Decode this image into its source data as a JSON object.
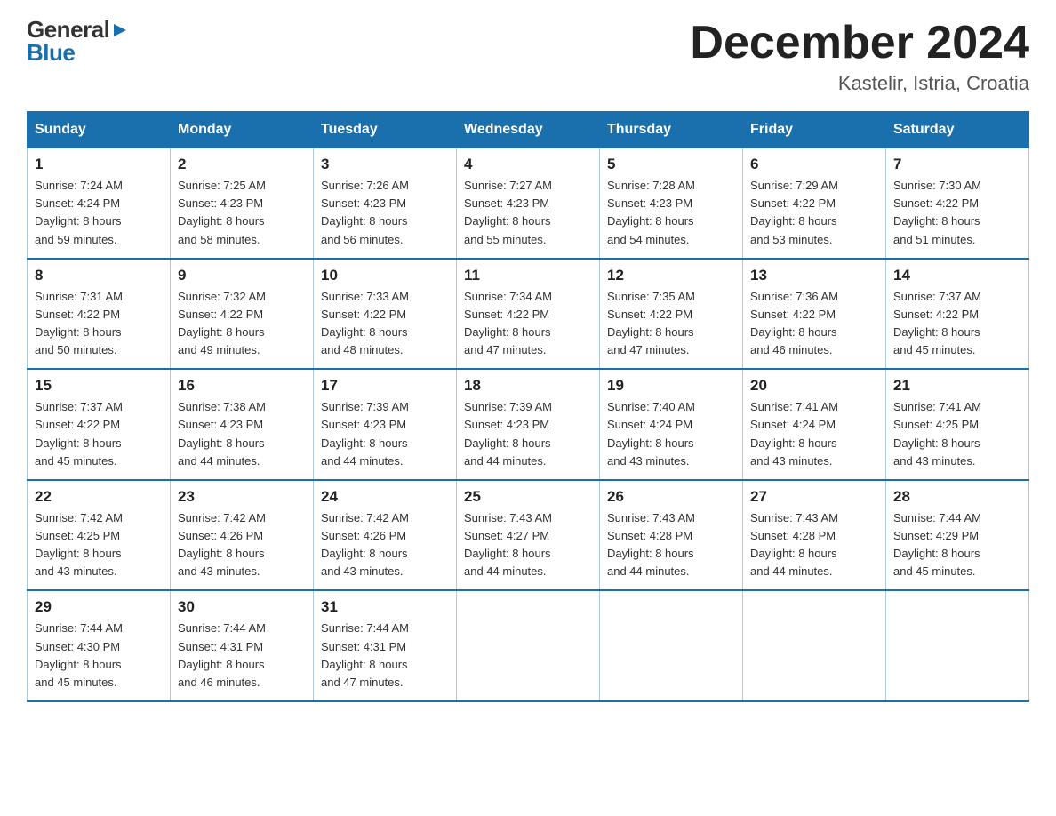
{
  "header": {
    "logo_general": "General",
    "logo_blue": "Blue",
    "month_title": "December 2024",
    "location": "Kastelir, Istria, Croatia"
  },
  "weekdays": [
    "Sunday",
    "Monday",
    "Tuesday",
    "Wednesday",
    "Thursday",
    "Friday",
    "Saturday"
  ],
  "weeks": [
    [
      {
        "day": "1",
        "sunrise": "7:24 AM",
        "sunset": "4:24 PM",
        "daylight": "8 hours and 59 minutes."
      },
      {
        "day": "2",
        "sunrise": "7:25 AM",
        "sunset": "4:23 PM",
        "daylight": "8 hours and 58 minutes."
      },
      {
        "day": "3",
        "sunrise": "7:26 AM",
        "sunset": "4:23 PM",
        "daylight": "8 hours and 56 minutes."
      },
      {
        "day": "4",
        "sunrise": "7:27 AM",
        "sunset": "4:23 PM",
        "daylight": "8 hours and 55 minutes."
      },
      {
        "day": "5",
        "sunrise": "7:28 AM",
        "sunset": "4:23 PM",
        "daylight": "8 hours and 54 minutes."
      },
      {
        "day": "6",
        "sunrise": "7:29 AM",
        "sunset": "4:22 PM",
        "daylight": "8 hours and 53 minutes."
      },
      {
        "day": "7",
        "sunrise": "7:30 AM",
        "sunset": "4:22 PM",
        "daylight": "8 hours and 51 minutes."
      }
    ],
    [
      {
        "day": "8",
        "sunrise": "7:31 AM",
        "sunset": "4:22 PM",
        "daylight": "8 hours and 50 minutes."
      },
      {
        "day": "9",
        "sunrise": "7:32 AM",
        "sunset": "4:22 PM",
        "daylight": "8 hours and 49 minutes."
      },
      {
        "day": "10",
        "sunrise": "7:33 AM",
        "sunset": "4:22 PM",
        "daylight": "8 hours and 48 minutes."
      },
      {
        "day": "11",
        "sunrise": "7:34 AM",
        "sunset": "4:22 PM",
        "daylight": "8 hours and 47 minutes."
      },
      {
        "day": "12",
        "sunrise": "7:35 AM",
        "sunset": "4:22 PM",
        "daylight": "8 hours and 47 minutes."
      },
      {
        "day": "13",
        "sunrise": "7:36 AM",
        "sunset": "4:22 PM",
        "daylight": "8 hours and 46 minutes."
      },
      {
        "day": "14",
        "sunrise": "7:37 AM",
        "sunset": "4:22 PM",
        "daylight": "8 hours and 45 minutes."
      }
    ],
    [
      {
        "day": "15",
        "sunrise": "7:37 AM",
        "sunset": "4:22 PM",
        "daylight": "8 hours and 45 minutes."
      },
      {
        "day": "16",
        "sunrise": "7:38 AM",
        "sunset": "4:23 PM",
        "daylight": "8 hours and 44 minutes."
      },
      {
        "day": "17",
        "sunrise": "7:39 AM",
        "sunset": "4:23 PM",
        "daylight": "8 hours and 44 minutes."
      },
      {
        "day": "18",
        "sunrise": "7:39 AM",
        "sunset": "4:23 PM",
        "daylight": "8 hours and 44 minutes."
      },
      {
        "day": "19",
        "sunrise": "7:40 AM",
        "sunset": "4:24 PM",
        "daylight": "8 hours and 43 minutes."
      },
      {
        "day": "20",
        "sunrise": "7:41 AM",
        "sunset": "4:24 PM",
        "daylight": "8 hours and 43 minutes."
      },
      {
        "day": "21",
        "sunrise": "7:41 AM",
        "sunset": "4:25 PM",
        "daylight": "8 hours and 43 minutes."
      }
    ],
    [
      {
        "day": "22",
        "sunrise": "7:42 AM",
        "sunset": "4:25 PM",
        "daylight": "8 hours and 43 minutes."
      },
      {
        "day": "23",
        "sunrise": "7:42 AM",
        "sunset": "4:26 PM",
        "daylight": "8 hours and 43 minutes."
      },
      {
        "day": "24",
        "sunrise": "7:42 AM",
        "sunset": "4:26 PM",
        "daylight": "8 hours and 43 minutes."
      },
      {
        "day": "25",
        "sunrise": "7:43 AM",
        "sunset": "4:27 PM",
        "daylight": "8 hours and 44 minutes."
      },
      {
        "day": "26",
        "sunrise": "7:43 AM",
        "sunset": "4:28 PM",
        "daylight": "8 hours and 44 minutes."
      },
      {
        "day": "27",
        "sunrise": "7:43 AM",
        "sunset": "4:28 PM",
        "daylight": "8 hours and 44 minutes."
      },
      {
        "day": "28",
        "sunrise": "7:44 AM",
        "sunset": "4:29 PM",
        "daylight": "8 hours and 45 minutes."
      }
    ],
    [
      {
        "day": "29",
        "sunrise": "7:44 AM",
        "sunset": "4:30 PM",
        "daylight": "8 hours and 45 minutes."
      },
      {
        "day": "30",
        "sunrise": "7:44 AM",
        "sunset": "4:31 PM",
        "daylight": "8 hours and 46 minutes."
      },
      {
        "day": "31",
        "sunrise": "7:44 AM",
        "sunset": "4:31 PM",
        "daylight": "8 hours and 47 minutes."
      },
      null,
      null,
      null,
      null
    ]
  ],
  "labels": {
    "sunrise": "Sunrise:",
    "sunset": "Sunset:",
    "daylight": "Daylight:"
  }
}
